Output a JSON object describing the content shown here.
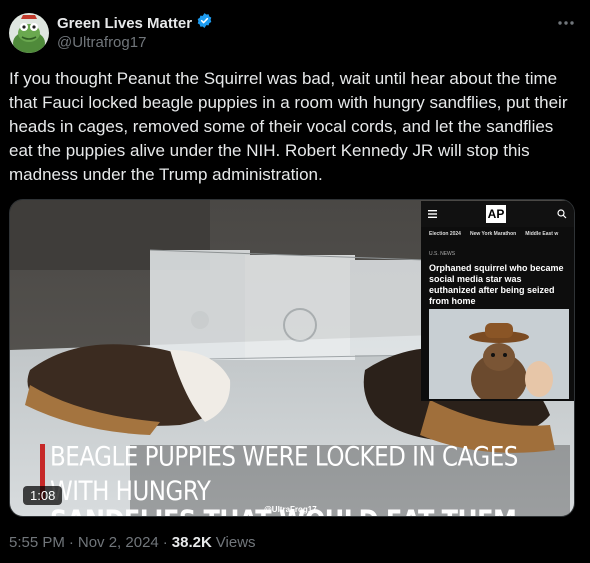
{
  "user": {
    "display_name": "Green Lives Matter",
    "handle": "@Ultrafrog17",
    "verified": true,
    "verified_color": "#1d9bf0"
  },
  "tweet": {
    "text": "If you thought Peanut the Squirrel was bad, wait until hear about the time that Fauci locked beagle puppies in a room with hungry sandflies, put their heads in cages, removed some of their vocal cords, and let the sandflies eat the puppies alive under the NIH. Robert Kennedy JR will stop this madness under the Trump administration."
  },
  "media": {
    "caption_line1": "BEAGLE PUPPIES WERE LOCKED IN CAGES WITH HUNGRY",
    "caption_line2": "SANDFLIES THAT WOULD EAT THEM ALIVE",
    "watermark": "@UltraFrog17",
    "duration": "1:08",
    "inset": {
      "logo": "AP",
      "nav": [
        "Election 2024",
        "New York Marathon",
        "Middle East w"
      ],
      "section": "U.S. NEWS",
      "headline": "Orphaned squirrel who became social media star was euthanized after being seized from home"
    }
  },
  "meta": {
    "time": "5:55 PM",
    "date": "Nov 2, 2024",
    "views_count": "38.2K",
    "views_label": "Views"
  },
  "icons": {
    "more": "more-horizontal-icon",
    "verified": "verified-badge-icon",
    "menu": "hamburger-menu-icon",
    "search": "search-icon"
  }
}
